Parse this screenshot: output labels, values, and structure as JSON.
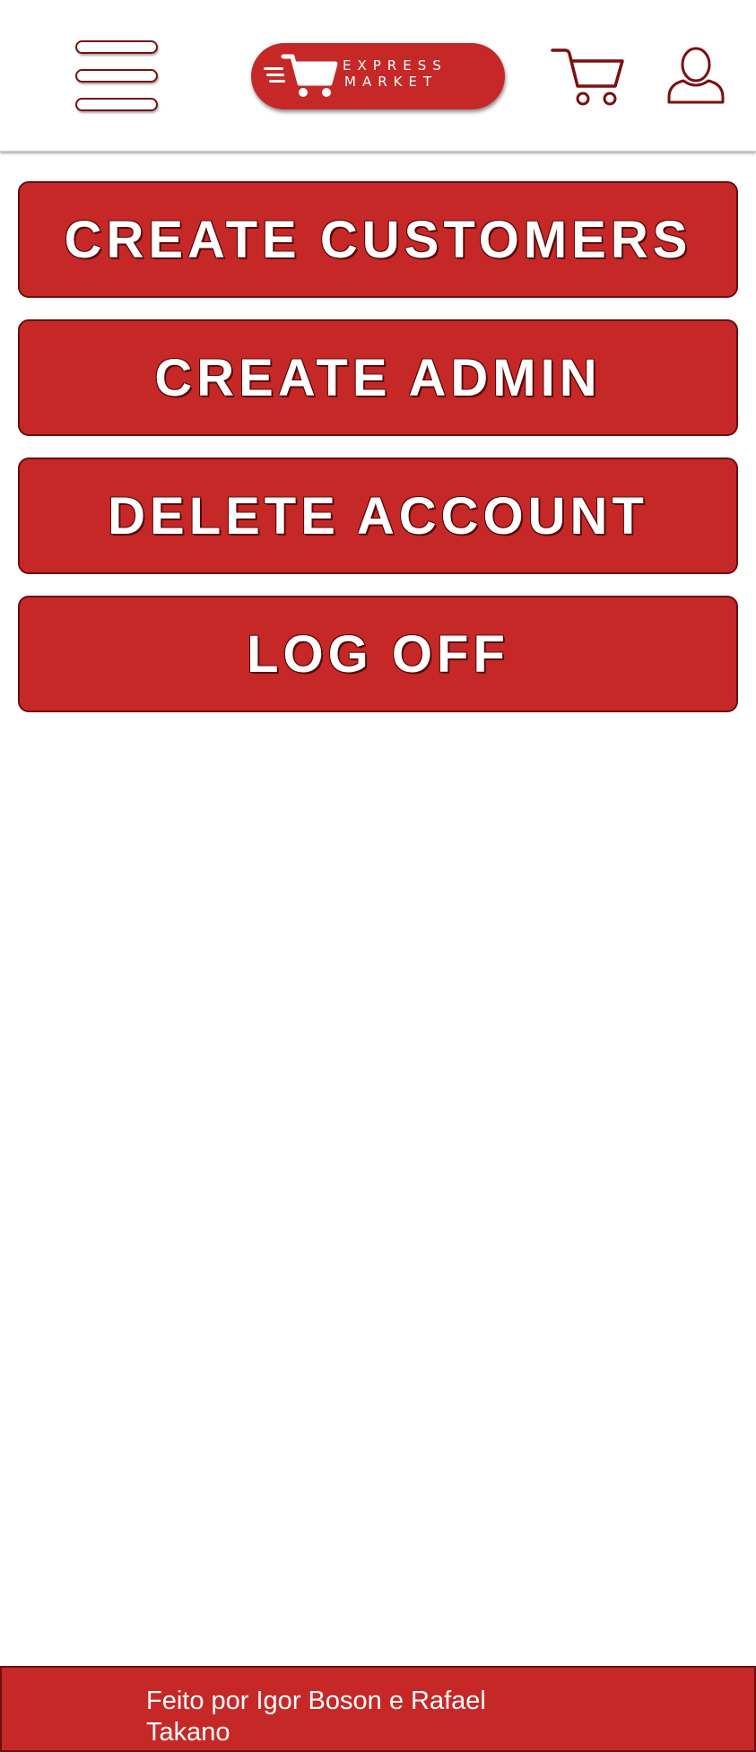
{
  "header": {
    "logo": {
      "line1": "EXPRESS",
      "line2": "MARKET"
    },
    "icons": {
      "menu": "hamburger-menu-icon",
      "cart": "shopping-cart-icon",
      "user": "user-profile-icon"
    }
  },
  "menu": {
    "items": [
      {
        "label": "CREATE CUSTOMERS"
      },
      {
        "label": "CREATE ADMIN"
      },
      {
        "label": "DELETE ACCOUNT"
      },
      {
        "label": "LOG OFF"
      }
    ]
  },
  "footer": {
    "text": "Feito por Igor Boson e Rafael Takano"
  },
  "colors": {
    "primary": "#c62828",
    "outline": "#6b0f0f",
    "background": "#ffffff",
    "text_on_primary": "#ffffff"
  }
}
